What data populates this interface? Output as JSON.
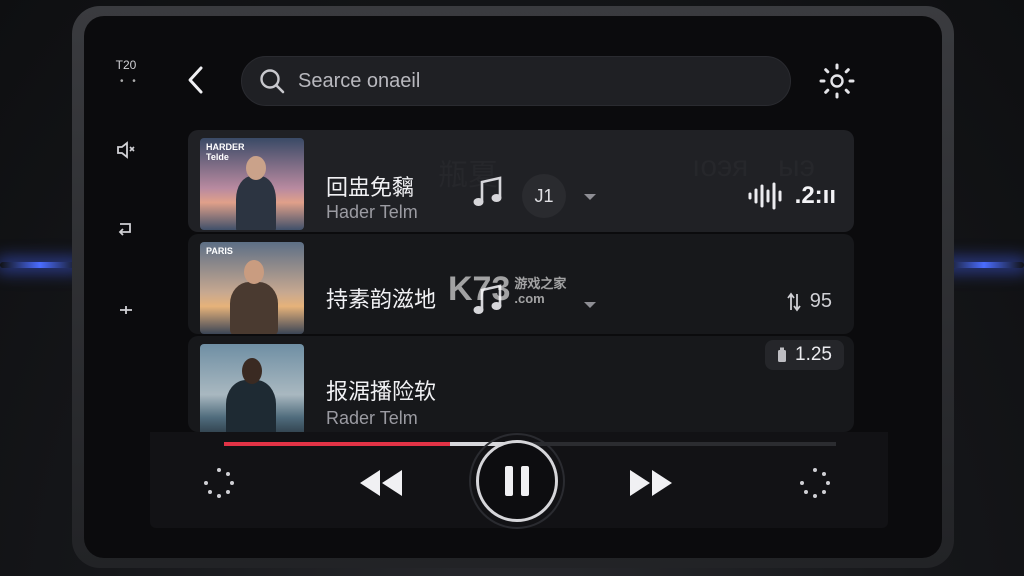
{
  "status": {
    "time": "T20"
  },
  "search": {
    "placeholder": "Searce onaeil"
  },
  "tracks": [
    {
      "title": "回盅免黐",
      "artist": "Hader Telm",
      "badge": "J1",
      "meter_value": ".2:ıı",
      "art_caption": "HARDER\nTelde"
    },
    {
      "title": "持素韵滋地",
      "stat_value": "95",
      "art_caption": "PARIS"
    },
    {
      "title": "报涺播险软",
      "artist": "Rader Telm",
      "chip_value": "1.25"
    }
  ],
  "ghost_text": [
    "瓶夏",
    "ıоэя",
    "ыэ"
  ],
  "player": {
    "progress_played": 0.37,
    "progress_buffered": 0.47
  },
  "watermark": {
    "brand": "K73",
    "line1": "游戏之家",
    "line2": ".com"
  },
  "icons": {
    "back": "chevron-left-icon",
    "search": "search-icon",
    "settings": "gear-icon",
    "note": "music-note-icon",
    "prev": "rewind-icon",
    "pause": "pause-icon",
    "next": "fast-forward-icon"
  }
}
